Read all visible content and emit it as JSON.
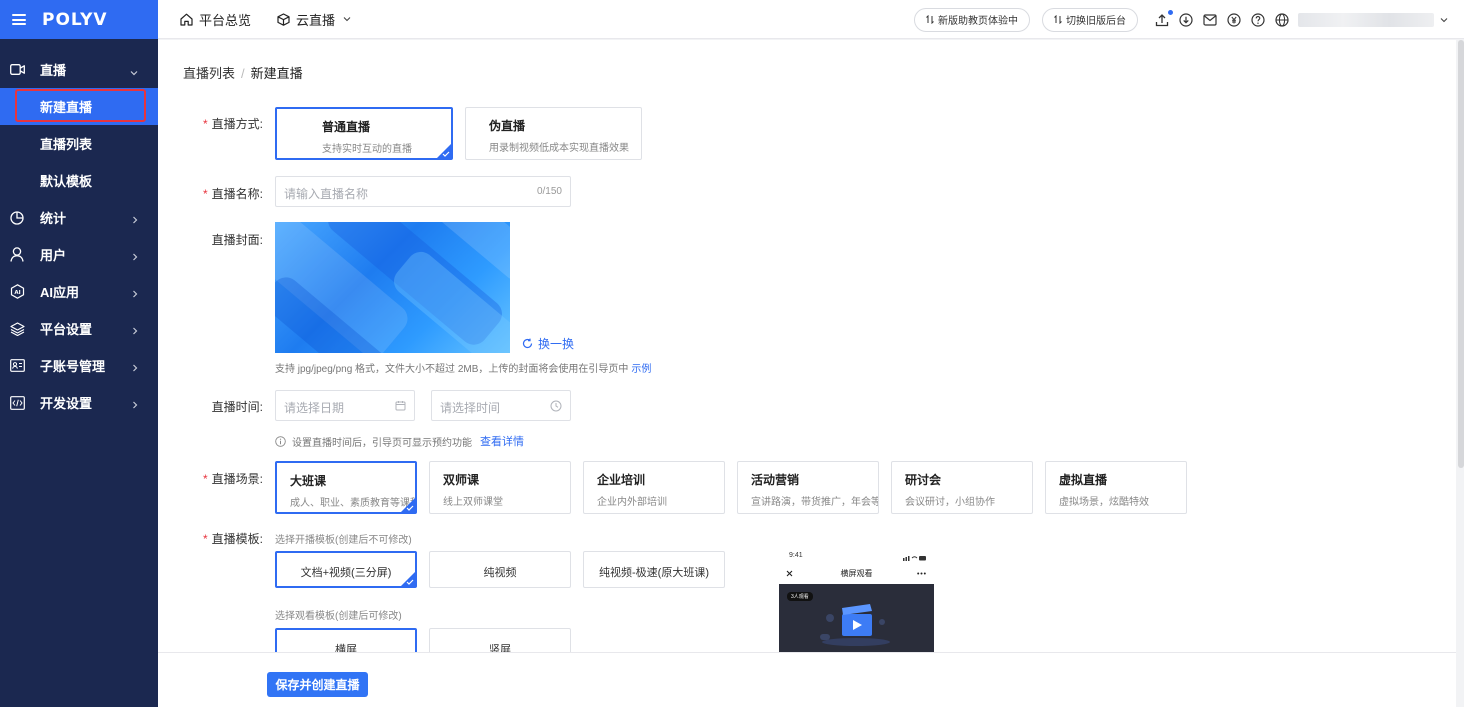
{
  "app": {
    "logo": "POLYV"
  },
  "sidebar": {
    "items": [
      {
        "label": "直播",
        "icon": "video-camera-icon",
        "expanded": true
      },
      {
        "label": "统计",
        "icon": "pie-chart-icon"
      },
      {
        "label": "用户",
        "icon": "user-icon"
      },
      {
        "label": "AI应用",
        "icon": "ai-icon"
      },
      {
        "label": "平台设置",
        "icon": "layers-icon"
      },
      {
        "label": "子账号管理",
        "icon": "id-card-icon"
      },
      {
        "label": "开发设置",
        "icon": "code-icon"
      }
    ],
    "sub_items": [
      {
        "label": "新建直播",
        "active": true
      },
      {
        "label": "直播列表"
      },
      {
        "label": "默认模板"
      }
    ]
  },
  "topbar": {
    "nav": [
      {
        "label": "平台总览",
        "icon": "home-icon"
      },
      {
        "label": "云直播",
        "icon": "cube-icon"
      }
    ],
    "buttons": [
      {
        "label": "新版助教页体验中"
      },
      {
        "label": "切换旧版后台"
      }
    ]
  },
  "breadcrumb": {
    "parent": "直播列表",
    "separator": "/",
    "current": "新建直播"
  },
  "form": {
    "mode": {
      "label": "直播方式:",
      "options": [
        {
          "title": "普通直播",
          "desc": "支持实时互动的直播",
          "selected": true
        },
        {
          "title": "伪直播",
          "desc": "用录制视频低成本实现直播效果"
        }
      ]
    },
    "name": {
      "label": "直播名称:",
      "placeholder": "请输入直播名称",
      "counter": "0/150"
    },
    "cover": {
      "label": "直播封面:",
      "swap_label": "换一换",
      "hint": "支持 jpg/jpeg/png 格式，文件大小不超过 2MB，上传的封面将会使用在引导页中",
      "hint_link": "示例"
    },
    "time": {
      "label": "直播时间:",
      "date_placeholder": "请选择日期",
      "time_placeholder": "请选择时间",
      "hint": "设置直播时间后，引导页可显示预约功能",
      "hint_link": "查看详情"
    },
    "scene": {
      "label": "直播场景:",
      "options": [
        {
          "title": "大班课",
          "desc": "成人、职业、素质教育等课程",
          "selected": true
        },
        {
          "title": "双师课",
          "desc": "线上双师课堂"
        },
        {
          "title": "企业培训",
          "desc": "企业内外部培训"
        },
        {
          "title": "活动营销",
          "desc": "宣讲路演，带货推广，年会等"
        },
        {
          "title": "研讨会",
          "desc": "会议研讨，小组协作"
        },
        {
          "title": "虚拟直播",
          "desc": "虚拟场景，炫酷特效"
        }
      ]
    },
    "template": {
      "label": "直播模板:",
      "broadcast_label": "选择开播模板(创建后不可修改)",
      "broadcast_options": [
        {
          "label": "文档+视频(三分屏)",
          "selected": true
        },
        {
          "label": "纯视频"
        },
        {
          "label": "纯视频-极速(原大班课)"
        }
      ],
      "watch_label": "选择观看模板(创建后可修改)",
      "watch_options": [
        {
          "label": "横屏",
          "selected": true
        },
        {
          "label": "竖屏"
        }
      ]
    },
    "preview": {
      "time": "9:41",
      "title": "横屏观看",
      "tag": "3人观看"
    }
  },
  "footer": {
    "submit_label": "保存并创建直播"
  },
  "colors": {
    "primary": "#2f6bf2",
    "sidebar_bg": "#1b2850",
    "required": "#e8343e"
  }
}
